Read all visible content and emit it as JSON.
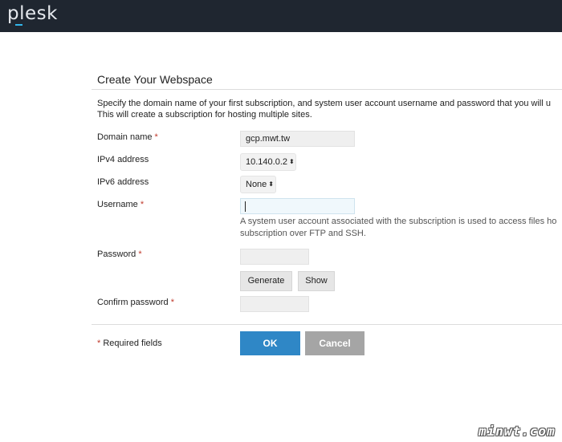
{
  "app": {
    "logo_text": "plesk"
  },
  "form": {
    "title": "Create Your Webspace",
    "description_lines": [
      "Specify the domain name of your first subscription, and system user account username and password that you will u",
      "This will create a subscription for hosting multiple sites."
    ],
    "required_marker": "*",
    "fields": {
      "domain": {
        "label": "Domain name",
        "value": "gcp.mwt.tw"
      },
      "ipv4": {
        "label": "IPv4 address",
        "value": "10.140.0.2"
      },
      "ipv6": {
        "label": "IPv6 address",
        "value": "None"
      },
      "username": {
        "label": "Username",
        "value": ""
      },
      "password": {
        "label": "Password",
        "value": ""
      },
      "confirm_password": {
        "label": "Confirm password",
        "value": ""
      }
    },
    "username_hint_lines": [
      "A system user account associated with the subscription is used to access files ho",
      "subscription over FTP and SSH."
    ],
    "buttons": {
      "generate": "Generate",
      "show": "Show",
      "ok": "OK",
      "cancel": "Cancel"
    },
    "required_fields_note": "Required fields"
  },
  "select_arrow_glyph": "▲▼",
  "watermark": "minwt.com",
  "colors": {
    "topbar": "#1f2630",
    "accent": "#32b5ea",
    "ok_button": "#2f87c6",
    "cancel_button": "#a5a5a5",
    "required": "#c0392b"
  }
}
